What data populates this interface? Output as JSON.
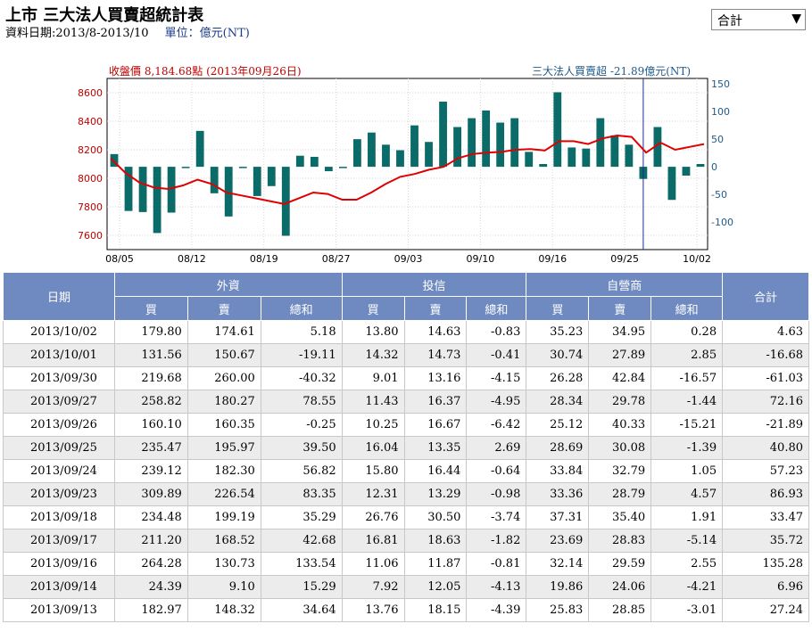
{
  "header": {
    "title": "上市 三大法人買賣超統計表",
    "date_range": "資料日期:2013/8-2013/10",
    "unit": "單位：億元(NT)",
    "select_value": "合計"
  },
  "legend": {
    "left": "收盤價 8,184.68點 (2013年09月26日)",
    "right": "三大法人買賣超 -21.89億元(NT)"
  },
  "chart_data": {
    "type": "bar+line",
    "x_labels": [
      "08/05",
      "08/12",
      "08/19",
      "08/27",
      "09/03",
      "09/10",
      "09/16",
      "09/25",
      "10/02"
    ],
    "left_axis": {
      "ticks": [
        "8600",
        "8400",
        "8200",
        "8000",
        "7800",
        "7600"
      ],
      "range": [
        7500,
        8700
      ]
    },
    "right_axis": {
      "ticks": [
        "150",
        "100",
        "50",
        "0",
        "-50",
        "-100"
      ],
      "range": [
        -150,
        160
      ]
    },
    "bars": [
      23,
      -80,
      -82,
      -120,
      -83,
      0,
      65,
      -48,
      -90,
      0,
      -53,
      -35,
      -125,
      20,
      18,
      -8,
      0,
      50,
      62,
      40,
      30,
      75,
      45,
      118,
      72,
      88,
      102,
      80,
      88,
      27,
      5,
      135,
      35,
      33,
      88,
      57,
      40,
      -22,
      72,
      -60,
      -16,
      5
    ],
    "close": [
      8140,
      8040,
      7970,
      7935,
      7925,
      7950,
      7990,
      7960,
      7900,
      7880,
      7860,
      7840,
      7820,
      7860,
      7900,
      7890,
      7850,
      7850,
      7900,
      7960,
      8010,
      8030,
      8060,
      8080,
      8140,
      8170,
      8180,
      8185,
      8200,
      8205,
      8195,
      8260,
      8260,
      8240,
      8280,
      8300,
      8290,
      8180,
      8250,
      8200,
      8220,
      8240
    ],
    "cursor_index": 37
  },
  "table": {
    "headers": {
      "date": "日期",
      "foreign": "外資",
      "trust": "投信",
      "dealer": "自營商",
      "total": "合計",
      "buy": "買",
      "sell": "賣",
      "net": "總和"
    },
    "rows": [
      [
        "2013/10/02",
        "179.80",
        "174.61",
        "5.18",
        "13.80",
        "14.63",
        "-0.83",
        "35.23",
        "34.95",
        "0.28",
        "4.63"
      ],
      [
        "2013/10/01",
        "131.56",
        "150.67",
        "-19.11",
        "14.32",
        "14.73",
        "-0.41",
        "30.74",
        "27.89",
        "2.85",
        "-16.68"
      ],
      [
        "2013/09/30",
        "219.68",
        "260.00",
        "-40.32",
        "9.01",
        "13.16",
        "-4.15",
        "26.28",
        "42.84",
        "-16.57",
        "-61.03"
      ],
      [
        "2013/09/27",
        "258.82",
        "180.27",
        "78.55",
        "11.43",
        "16.37",
        "-4.95",
        "28.34",
        "29.78",
        "-1.44",
        "72.16"
      ],
      [
        "2013/09/26",
        "160.10",
        "160.35",
        "-0.25",
        "10.25",
        "16.67",
        "-6.42",
        "25.12",
        "40.33",
        "-15.21",
        "-21.89"
      ],
      [
        "2013/09/25",
        "235.47",
        "195.97",
        "39.50",
        "16.04",
        "13.35",
        "2.69",
        "28.69",
        "30.08",
        "-1.39",
        "40.80"
      ],
      [
        "2013/09/24",
        "239.12",
        "182.30",
        "56.82",
        "15.80",
        "16.44",
        "-0.64",
        "33.84",
        "32.79",
        "1.05",
        "57.23"
      ],
      [
        "2013/09/23",
        "309.89",
        "226.54",
        "83.35",
        "12.31",
        "13.29",
        "-0.98",
        "33.36",
        "28.79",
        "4.57",
        "86.93"
      ],
      [
        "2013/09/18",
        "234.48",
        "199.19",
        "35.29",
        "26.76",
        "30.50",
        "-3.74",
        "37.31",
        "35.40",
        "1.91",
        "33.47"
      ],
      [
        "2013/09/17",
        "211.20",
        "168.52",
        "42.68",
        "16.81",
        "18.63",
        "-1.82",
        "23.69",
        "28.83",
        "-5.14",
        "35.72"
      ],
      [
        "2013/09/16",
        "264.28",
        "130.73",
        "133.54",
        "11.06",
        "11.87",
        "-0.81",
        "32.14",
        "29.59",
        "2.55",
        "135.28"
      ],
      [
        "2013/09/14",
        "24.39",
        "9.10",
        "15.29",
        "7.92",
        "12.05",
        "-4.13",
        "19.86",
        "24.06",
        "-4.21",
        "6.96"
      ],
      [
        "2013/09/13",
        "182.97",
        "148.32",
        "34.64",
        "13.76",
        "18.15",
        "-4.39",
        "25.83",
        "28.85",
        "-3.01",
        "27.24"
      ]
    ]
  }
}
